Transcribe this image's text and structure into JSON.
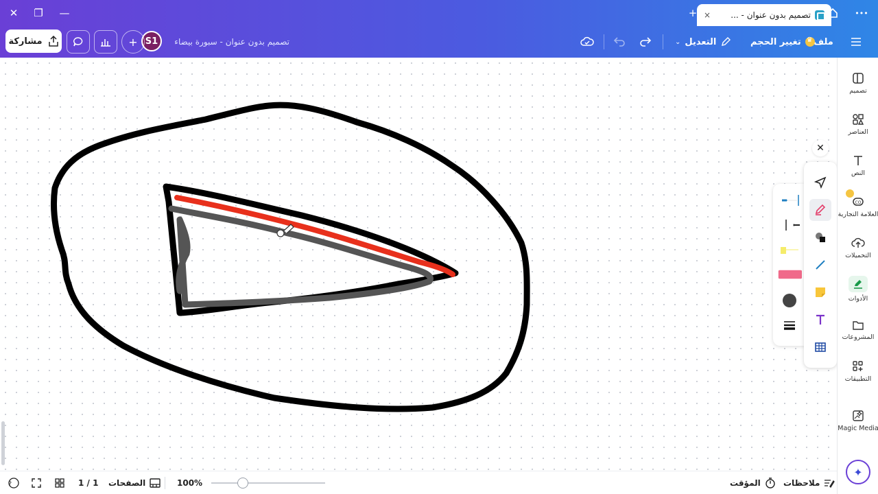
{
  "browser": {
    "tab_title": "تصميم بدون عنوان - ...",
    "tab_close": "×",
    "new_tab": "+",
    "window_minimize": "—",
    "window_restore": "❐",
    "window_close": "✕",
    "more": "•••"
  },
  "topbar": {
    "menu_icon": "hamburger-icon",
    "file_label": "ملف",
    "resize_label": "تغيير الحجم",
    "edit_label": "التعديل",
    "doc_title": "تصميم بدون عنوان - سبورة بيضاء",
    "avatar_initials": "S1",
    "share_label": "مشاركة"
  },
  "sidebar": {
    "items": [
      {
        "label": "تصميم",
        "icon": "design-icon"
      },
      {
        "label": "العناصر",
        "icon": "elements-icon"
      },
      {
        "label": "النص",
        "icon": "text-icon"
      },
      {
        "label": "العلامة التجارية",
        "icon": "brand-icon"
      },
      {
        "label": "التحميلات",
        "icon": "upload-icon"
      },
      {
        "label": "الأدوات",
        "icon": "tools-icon"
      },
      {
        "label": "المشروعات",
        "icon": "folder-icon"
      },
      {
        "label": "التطبيقات",
        "icon": "apps-icon"
      },
      {
        "label": "Magic Media",
        "icon": "magic-media-icon"
      }
    ]
  },
  "bottombar": {
    "notes_label": "ملاحظات",
    "timer_label": "المؤقت",
    "zoom_value": "100%",
    "pages_label": "الصفحات",
    "page_count": "1 / 1"
  },
  "colors": {
    "accent_purple": "#6a3fd6",
    "accent_blue": "#2f86e6",
    "stroke_black": "#000000",
    "stroke_red": "#e8301c",
    "stroke_gray": "#555555"
  }
}
